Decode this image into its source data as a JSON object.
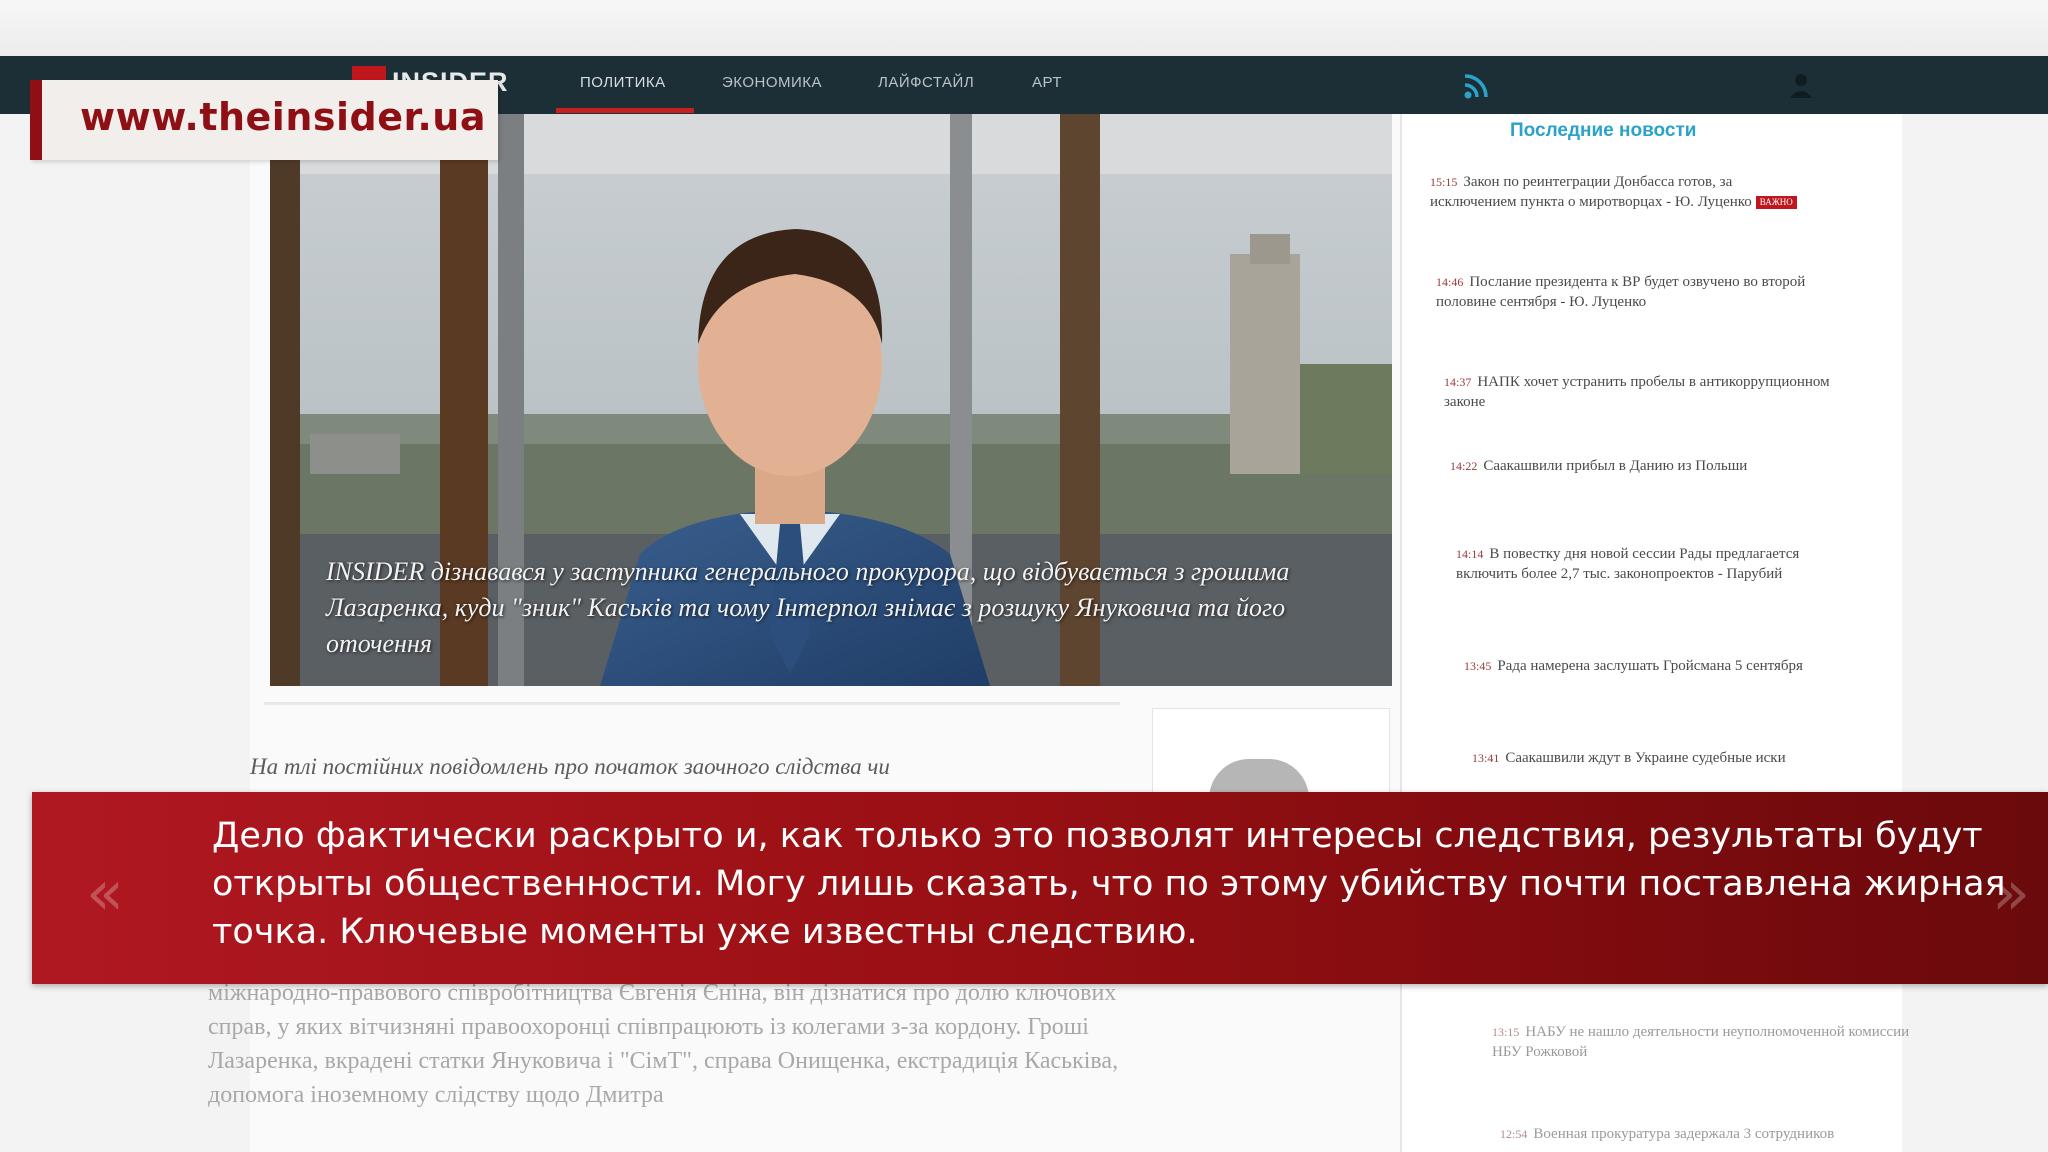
{
  "watermark_url": "www.theinsider.ua",
  "nav": {
    "logo": "INSIDER",
    "items": [
      {
        "label": "ПОЛИТИКА"
      },
      {
        "label": "ЭКОНОМИКА"
      },
      {
        "label": "ЛАЙФСТАЙЛ"
      },
      {
        "label": "АРТ"
      }
    ],
    "icons": [
      "rss-icon",
      "user-icon"
    ],
    "accent": "#c62020"
  },
  "photo": {
    "caption": "INSIDER дізнавався у заступника генерального прокурора, що відбувається з грошима Лазаренка, куди \"зник\" Каськів та чому Інтерпол знімає з розшуку Януковича та його оточення"
  },
  "sidebar": {
    "title": "Последние новости",
    "news": [
      {
        "time": "15:15",
        "text": "Закон по реинтеграции Донбасса готов, за исключением пункта о миротворцах - Ю. Луценко",
        "badge": "ВАЖНО"
      },
      {
        "time": "14:46",
        "text": "Послание президента к ВР будет озвучено во второй половине сентября - Ю. Луценко"
      },
      {
        "time": "14:37",
        "text": "НАПК хочет устранить пробелы в антикоррупционном законе"
      },
      {
        "time": "14:22",
        "text": "Саакашвили прибыл в Данию из Польши"
      },
      {
        "time": "14:14",
        "text": "В повестку дня новой сессии Рады предлагается включить более 2,7 тыс. законопроектов - Парубий"
      },
      {
        "time": "13:45",
        "text": "Рада намерена заслушать Гройсмана 5 сентября"
      },
      {
        "time": "13:41",
        "text": "Саакашвили ждут в Украине судебные иски"
      },
      {
        "time": "13:15",
        "text": "НАБУ не нашло деятельности неуполномоченной комиссии НБУ Рожковой"
      },
      {
        "time": "12:54",
        "text": "Военная прокуратура задержала 3 сотрудников"
      }
    ]
  },
  "article": {
    "lead": "На тлі постійних повідомлень про початок заочного слідства чи",
    "body": "міжнародно-правового співробітництва Євгенія Єніна, він дізнатися про долю ключових справ, у яких вітчизняні правоохоронці співпрацюють із колегами з-за кордону. Гроші Лазаренка, вкрадені статки Януковича і \"СімТ\", справа Онищенка, екстрадиція Каськіва, допомога іноземному слідству щодо Дмитра"
  },
  "subtitle": {
    "text": "Дело фактически раскрыто и, как только это позволят интересы следствия, результаты будут открыты общественности. Могу лишь сказать, что по этому убийству почти поставлена жирная точка. Ключевые моменты уже известны следствию.",
    "bg_color": "#9a1014",
    "prev_arrow": "«",
    "next_arrow": "»"
  }
}
